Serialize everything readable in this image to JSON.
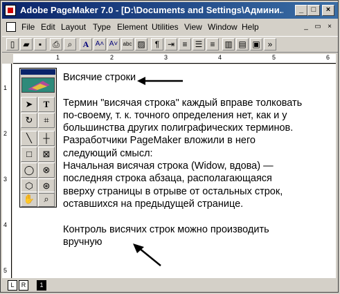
{
  "window": {
    "title": "Adobe PageMaker 7.0 - [D:\\Documents and Settings\\Админи..."
  },
  "menu": [
    "File",
    "Edit",
    "Layout",
    "Type",
    "Element",
    "Utilities",
    "View",
    "Window",
    "Help"
  ],
  "ruler": {
    "h": [
      "1",
      "2",
      "3",
      "4",
      "5",
      "6"
    ],
    "v": [
      "1",
      "2",
      "3",
      "4",
      "5"
    ]
  },
  "content": {
    "heading": "Висячие строки",
    "lines": [
      "Термин \"висячая строка\" каждый вправе толковать",
      "по-своему, т. к. точного определения нет, как и у",
      "большинства других полиграфических терминов.",
      "Разработчики PageMaker вложили в него",
      "следующий смысл:",
      "Начальная висячая строка (Widow, вдова) —",
      "последняя строка абзаца, располагающаяся",
      "вверху страницы в отрыве от остальных строк,",
      "оставшихся на предыдущей странице."
    ],
    "footer_lines": [
      "Контроль висячих строк можно производить",
      "вручную"
    ]
  },
  "pages": {
    "left": "L",
    "right": "R",
    "current": "1"
  }
}
